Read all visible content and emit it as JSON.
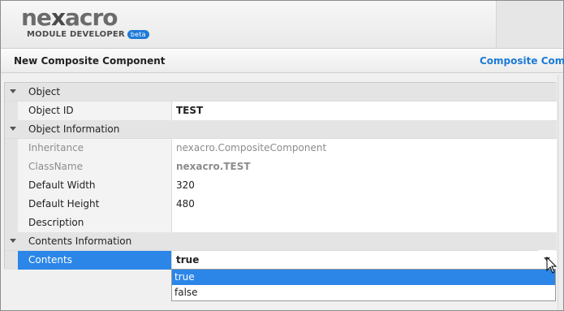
{
  "app": {
    "logo_word_pre": "ne",
    "logo_word_x": "x",
    "logo_word_post": "acro",
    "logo_sub": "MODULE DEVELOPER",
    "logo_badge": "beta"
  },
  "titlebar": {
    "title": "New Composite Component",
    "link": "Composite Compo"
  },
  "grid": {
    "groups": [
      {
        "name": "Object"
      },
      {
        "name": "Object Information"
      },
      {
        "name": "Contents Information"
      }
    ],
    "rows": [
      {
        "key": "Object ID",
        "value": "TEST"
      },
      {
        "key": "Inheritance",
        "value": "nexacro.CompositeComponent"
      },
      {
        "key": "ClassName",
        "value": "nexacro.TEST"
      },
      {
        "key": "Default Width",
        "value": "320"
      },
      {
        "key": "Default Height",
        "value": "480"
      },
      {
        "key": "Description",
        "value": ""
      },
      {
        "key": "Contents",
        "value": "true"
      }
    ]
  },
  "dropdown": {
    "options": [
      "true",
      "false"
    ],
    "selected": "true"
  },
  "colors": {
    "accent": "#2b86e8",
    "link": "#1c7ad6",
    "group_bg": "#e4e4e4"
  },
  "icons": {
    "expand": "triangle-down-icon",
    "combo": "chevron-down-icon",
    "cursor": "mouse-pointer-icon"
  }
}
